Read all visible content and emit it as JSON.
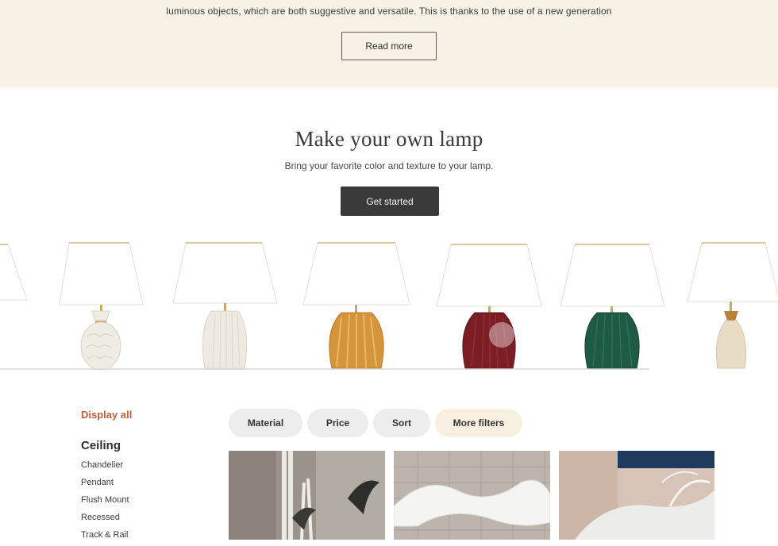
{
  "intro": {
    "text": "luminous objects, which are both suggestive and versatile. This is thanks to the use of a new generation",
    "read_more_label": "Read more"
  },
  "hero": {
    "title": "Make your own lamp",
    "subtitle": "Bring your favorite color and texture to your lamp.",
    "cta_label": "Get started"
  },
  "lamps": [
    {
      "name": "pineapple-white-lamp",
      "base_color": "#efece4"
    },
    {
      "name": "ribbed-ivory-lamp",
      "base_color": "#eeeae2"
    },
    {
      "name": "gold-ribbed-lamp",
      "base_color": "#d5953a"
    },
    {
      "name": "burgundy-ribbed-lamp",
      "base_color": "#7a1e24"
    },
    {
      "name": "green-ribbed-lamp",
      "base_color": "#1f5a43"
    },
    {
      "name": "cream-slim-lamp",
      "base_color": "#e8dcc4"
    }
  ],
  "sidebar": {
    "display_all": "Display all",
    "heading": "Ceiling",
    "items": [
      "Chandelier",
      "Pendant",
      "Flush Mount",
      "Recessed",
      "Track & Rail"
    ]
  },
  "filters": {
    "material": "Material",
    "price": "Price",
    "sort": "Sort",
    "more": "More filters"
  },
  "colors": {
    "accent": "#b9623d",
    "band": "#f7f1e6",
    "dark_button": "#3a3a3a"
  }
}
